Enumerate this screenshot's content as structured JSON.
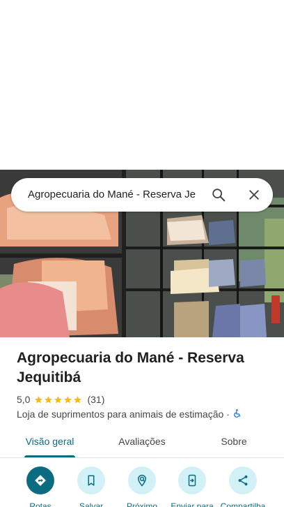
{
  "search": {
    "query": "Agropecuaria do Mané - Reserva Je",
    "search_icon": "search-icon",
    "close_icon": "close-icon"
  },
  "place": {
    "name": "Agropecuaria do Mané - Reserva Jequitibá",
    "rating": "5,0",
    "stars": 5,
    "reviews_count": "(31)",
    "category": "Loja de suprimentos para animais de estimação",
    "separator": "·",
    "accessibility_icon": "wheelchair-icon"
  },
  "tabs": [
    {
      "label": "Visão geral",
      "active": true
    },
    {
      "label": "Avaliações",
      "active": false
    },
    {
      "label": "Sobre",
      "active": false
    }
  ],
  "actions": [
    {
      "label": "Rotas",
      "icon": "directions-icon"
    },
    {
      "label": "Salvar",
      "icon": "bookmark-icon"
    },
    {
      "label": "Próximo",
      "icon": "nearby-icon"
    },
    {
      "label": "Enviar para",
      "icon": "send-to-phone-icon"
    },
    {
      "label": "Compartilha",
      "icon": "share-icon"
    }
  ],
  "colors": {
    "accent": "#0b6b80",
    "action_bg": "#d2f1f6",
    "star": "#fbbc04"
  }
}
